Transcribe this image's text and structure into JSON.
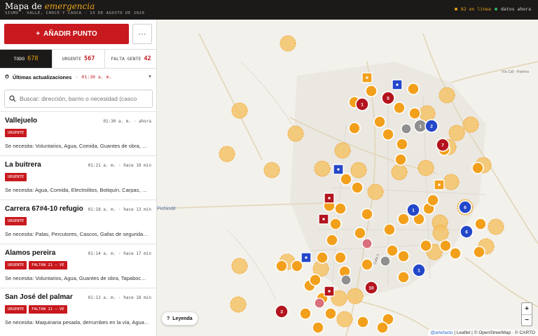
{
  "header": {
    "title_plain": "Mapa de",
    "title_accent": "emergencia",
    "subtitle": "SISMO · VALLE, CHOCÓ Y CAUCA · 13 DE AGOSTO DE 2026",
    "online_text": "82 en línea",
    "data_text": "datos ahora",
    "colors": {
      "online": "#e8a317",
      "data": "#2fb36a"
    }
  },
  "toolbar": {
    "add_label": "AÑADIR PUNTO",
    "add_icon": "plus-icon",
    "more_icon": "ellipsis-icon"
  },
  "tabs": [
    {
      "label": "TODO",
      "count": "678",
      "active": true
    },
    {
      "label": "URGENTE",
      "count": "567",
      "active": false
    },
    {
      "label": "FALTA GENTE",
      "count": "42",
      "active": false
    }
  ],
  "updates": {
    "label": "Últimas actualizaciones",
    "time": "01:30 a. m.",
    "icon": "clock-icon",
    "chevron": "chevron-down-icon"
  },
  "search": {
    "placeholder": "Buscar: dirección, barrio o necesidad (casco",
    "icon": "search-icon"
  },
  "items": [
    {
      "title": "Vallejuelo",
      "time": "01:30 a. m.",
      "ago": "ahora",
      "badges": [
        "URGENTE"
      ],
      "need": "Se necesita: Voluntarios, Agua, Comida, Guantes de obra, …"
    },
    {
      "title": "La buitrera",
      "time": "01:21 a. m.",
      "ago": "hace 10 min",
      "badges": [
        "URGENTE"
      ],
      "need": "Se necesita: Agua, Comida, Electrolitos, Botiquín, Carpas, …"
    },
    {
      "title": "Carrera 67#4-10 refugio",
      "time": "01:18 a. m.",
      "ago": "hace 13 min",
      "badges": [
        "URGENTE"
      ],
      "need": "Se necesita: Palas, Percutores, Cascos, Gafas de segurida…"
    },
    {
      "title": "Alamos pereira",
      "time": "01:14 a. m.",
      "ago": "hace 17 min",
      "badges": [
        "URGENTE",
        "FALTAN 21 — VE"
      ],
      "need": "Se necesita: Voluntarios, Agua, Guantes de obra, Tapaboc…"
    },
    {
      "title": "San José del palmar",
      "time": "01:13 a. m.",
      "ago": "hace 18 min",
      "badges": [
        "URGENTE",
        "FALTAN 11 — VE"
      ],
      "need": "Se necesita: Maquinaria pesada, derrumbes en la vía, Agua…"
    }
  ],
  "map": {
    "place_label_1": "Pichindé",
    "place_label_2": "Vía Cali - Palmira",
    "place_label_3": "Calle 5",
    "legend_label": "Leyenda",
    "legend_icon": "question-icon",
    "zoom_in": "+",
    "zoom_out": "−",
    "attribution_link": "@artefacto",
    "attribution_rest": " | Leaflet | © OpenStreetMap · © CARTO",
    "colors": {
      "orange": "#f2a01c",
      "halo": "#f5c46a",
      "red": "#b3141d",
      "blue": "#2347c9",
      "gray": "#8f8f8f",
      "pink": "#d9707c"
    },
    "cluster_numbers": [
      "1",
      "5",
      "7",
      "1",
      "6",
      "1",
      "1",
      "10",
      "3",
      "2",
      "6"
    ]
  }
}
